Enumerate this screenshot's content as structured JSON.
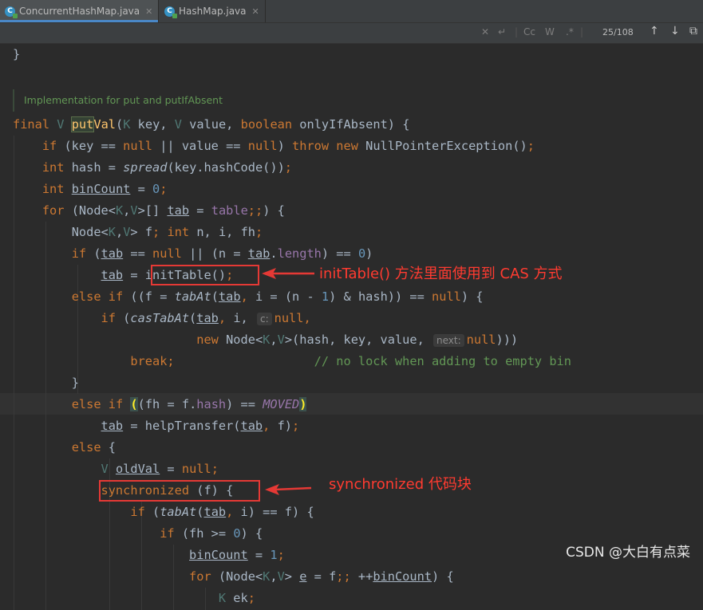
{
  "tabs": [
    {
      "label": "ConcurrentHashMap.java",
      "active": true,
      "icon": "java-class-icon"
    },
    {
      "label": "HashMap.java",
      "active": false,
      "icon": "java-class-icon"
    }
  ],
  "search": {
    "toggles": [
      "Cc",
      "W",
      ".*"
    ],
    "match_count": "25/108"
  },
  "doc_comment": "Implementation for put and putIfAbsent",
  "code": {
    "closing_brace": "}",
    "sig": {
      "final": "final",
      "V": "V",
      "put": "put",
      "Val": "Val",
      "open": "(",
      "K": "K",
      "key": " key, ",
      "V2": "V",
      "value": " value, ",
      "boolean": "boolean",
      "rest": " onlyIfAbsent) {"
    },
    "l1": {
      "if": "if",
      "a": " (key == ",
      "null1": "null",
      "b": " || value == ",
      "null2": "null",
      "c": ") ",
      "throw": "throw",
      "sp": " ",
      "new": "new",
      "d": " NullPointerException()",
      "semi": ";"
    },
    "l2": {
      "int": "int",
      "a": " hash = ",
      "spread": "spread",
      "b": "(key.hashCode())",
      "semi": ";"
    },
    "l3": {
      "int": "int",
      "sp": " ",
      "binCount": "binCount",
      "a": " = ",
      "zero": "0",
      "semi": ";"
    },
    "l4": {
      "for": "for",
      "a": " (Node<",
      "K": "K",
      "comma": ",",
      "V": "V",
      "b": ">[] ",
      "tab": "tab",
      "c": " = ",
      "table": "table",
      "semis": ";;",
      "d": ") {"
    },
    "l5": {
      "a": "Node<",
      "K": "K",
      "comma": ",",
      "V": "V",
      "b": "> f",
      "s1": ";",
      "sp1": " ",
      "int": "int",
      "c": " n, i, fh",
      "s2": ";"
    },
    "l6": {
      "if": "if",
      "a": " (",
      "tab1": "tab",
      "b": " == ",
      "null": "null",
      "c": " || (n = ",
      "tab2": "tab",
      "dot": ".",
      "length": "length",
      "d": ") == ",
      "zero": "0",
      "e": ")"
    },
    "l7": {
      "tab": "tab",
      "a": " = ",
      "init": "initTable()",
      "semi": ";"
    },
    "l8": {
      "else": "else",
      "sp": " ",
      "if": "if",
      "a": " ((f = ",
      "tabAt": "tabAt",
      "b": "(",
      "tab": "tab",
      "comma": ",",
      "c": " i = (n - ",
      "one": "1",
      "d": ") & hash)) == ",
      "null": "null",
      "e": ") {"
    },
    "l9": {
      "if": "if",
      "a": " (",
      "casTabAt": "casTabAt",
      "b": "(",
      "tab": "tab",
      "comma": ",",
      "c": " i, ",
      "hint": "c:",
      "null": "null",
      "comma2": ","
    },
    "l10": {
      "new": "new",
      "a": " Node<",
      "K": "K",
      "comma": ",",
      "V": "V",
      "b": ">(hash, key, value, ",
      "hint": "next:",
      "null": "null",
      "c": ")))"
    },
    "l11": {
      "break": "break",
      "semi": ";",
      "pad": "                   ",
      "comment": "// no lock when adding to empty bin"
    },
    "l12": {
      "brace": "}"
    },
    "l13": {
      "else": "else",
      "sp": " ",
      "if": "if",
      "sp2": " ",
      "ob": "(",
      "a": "(fh = f.",
      "hash": "hash",
      "b": ") == ",
      "moved": "MOVED",
      "cb": ")"
    },
    "l14": {
      "tab1": "tab",
      "a": " = helpTransfer(",
      "tab2": "tab",
      "comma": ",",
      "b": " f)",
      "semi": ";"
    },
    "l15": {
      "else": "else",
      "a": " {"
    },
    "l16": {
      "V": "V",
      "sp": " ",
      "oldVal": "oldVal",
      "a": " = ",
      "null": "null",
      "semi": ";"
    },
    "l17": {
      "sync": "synchronized",
      "a": " (f) {"
    },
    "l18": {
      "if": "if",
      "a": " (",
      "tabAt": "tabAt",
      "b": "(",
      "tab": "tab",
      "comma": ",",
      "c": " i) == f) {"
    },
    "l19": {
      "if": "if",
      "a": " (fh >= ",
      "zero": "0",
      "b": ") {"
    },
    "l20": {
      "binCount": "binCount",
      "a": " = ",
      "one": "1",
      "semi": ";"
    },
    "l21": {
      "for": "for",
      "a": " (Node<",
      "K": "K",
      "comma": ",",
      "V": "V",
      "b": "> ",
      "e": "e",
      "c": " = f",
      "semis": ";;",
      "d": " ++",
      "binCount": "binCount",
      "e2": ") {"
    },
    "l22": {
      "K": "K",
      "a": " ek",
      "semi": ";"
    }
  },
  "annotations": {
    "init_table": "initTable() 方法里面使用到 CAS 方式",
    "synchronized": "synchronized 代码块",
    "color": "#e53935"
  },
  "watermark": "CSDN @大白有点菜"
}
